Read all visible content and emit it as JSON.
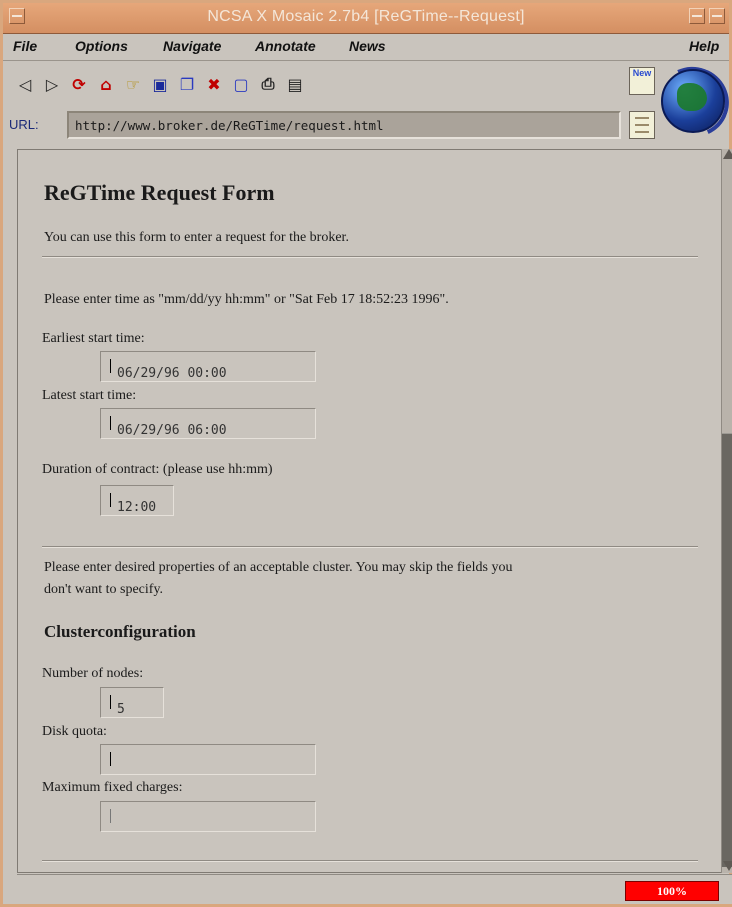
{
  "window": {
    "title": "NCSA X Mosaic 2.7b4 [ReGTime--Request]"
  },
  "menu": [
    "File",
    "Options",
    "Navigate",
    "Annotate",
    "News",
    "Help"
  ],
  "toolbar": {
    "icons": [
      "back-arrow-icon",
      "forward-arrow-icon",
      "reload-icon",
      "home-icon",
      "open-icon",
      "save-icon",
      "clone-icon",
      "close-window-icon",
      "new-page-icon",
      "print-icon",
      "document-icon"
    ],
    "url_label": "URL:",
    "url_value": "http://www.broker.de/ReGTime/request.html",
    "new_icon_text": "New"
  },
  "page": {
    "title": "ReGTime Request Form",
    "intro": "You can use this form to enter a request for the broker.",
    "time_instructions": "Please enter time as \"mm/dd/yy hh:mm\" or \"Sat Feb 17 18:52:23 1996\".",
    "earliest_label": "Earliest start time:",
    "earliest_value": "06/29/96 00:00",
    "latest_label": "Latest start time:",
    "latest_value": "06/29/96 06:00",
    "duration_label": "Duration of contract: (please use hh:mm)",
    "duration_value": "12:00",
    "properties_text_1": "Please enter desired properties of an acceptable cluster. You may skip the fields you",
    "properties_text_2": "don't want to specify.",
    "cluster_heading": "Clusterconfiguration",
    "nodes_label": "Number of nodes:",
    "nodes_value": "5",
    "disk_label": "Disk quota:",
    "disk_value": "",
    "charges_label": "Maximum fixed charges:",
    "charges_value": ""
  },
  "status": {
    "progress_text": "100%",
    "progress_fraction": 1.0
  }
}
